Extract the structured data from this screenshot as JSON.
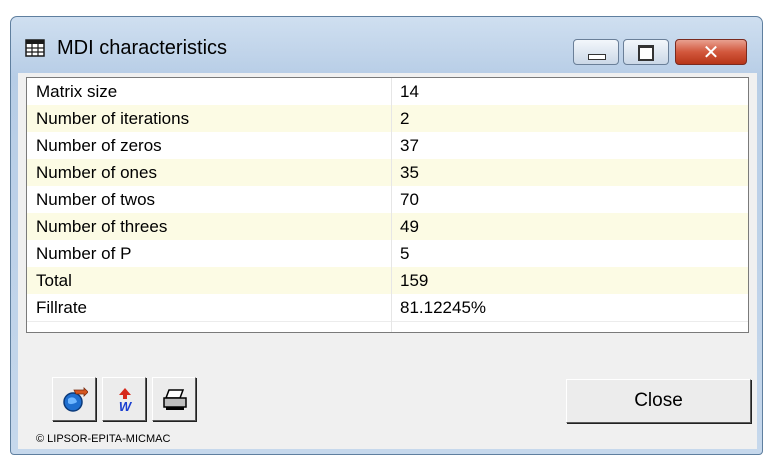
{
  "window": {
    "title": "MDI characteristics"
  },
  "table": {
    "rows": [
      {
        "label": "Matrix size",
        "value": "14"
      },
      {
        "label": "Number of iterations",
        "value": "2"
      },
      {
        "label": "Number of zeros",
        "value": "37"
      },
      {
        "label": "Number of ones",
        "value": "35"
      },
      {
        "label": "Number of twos",
        "value": "70"
      },
      {
        "label": "Number of threes",
        "value": "49"
      },
      {
        "label": "Number of P",
        "value": "5"
      },
      {
        "label": "Total",
        "value": "159"
      },
      {
        "label": "Fillrate",
        "value": "81.12245%"
      }
    ]
  },
  "toolbar": {
    "close_label": "Close",
    "icons": [
      "export-icon",
      "word-export-icon",
      "print-icon"
    ]
  },
  "footer": {
    "copyright": "© LIPSOR-EPITA-MICMAC"
  },
  "colors": {
    "alt_row": "#fcfbe4",
    "close_button": "#c94a2e",
    "titlebar": "#c3d7ed"
  }
}
